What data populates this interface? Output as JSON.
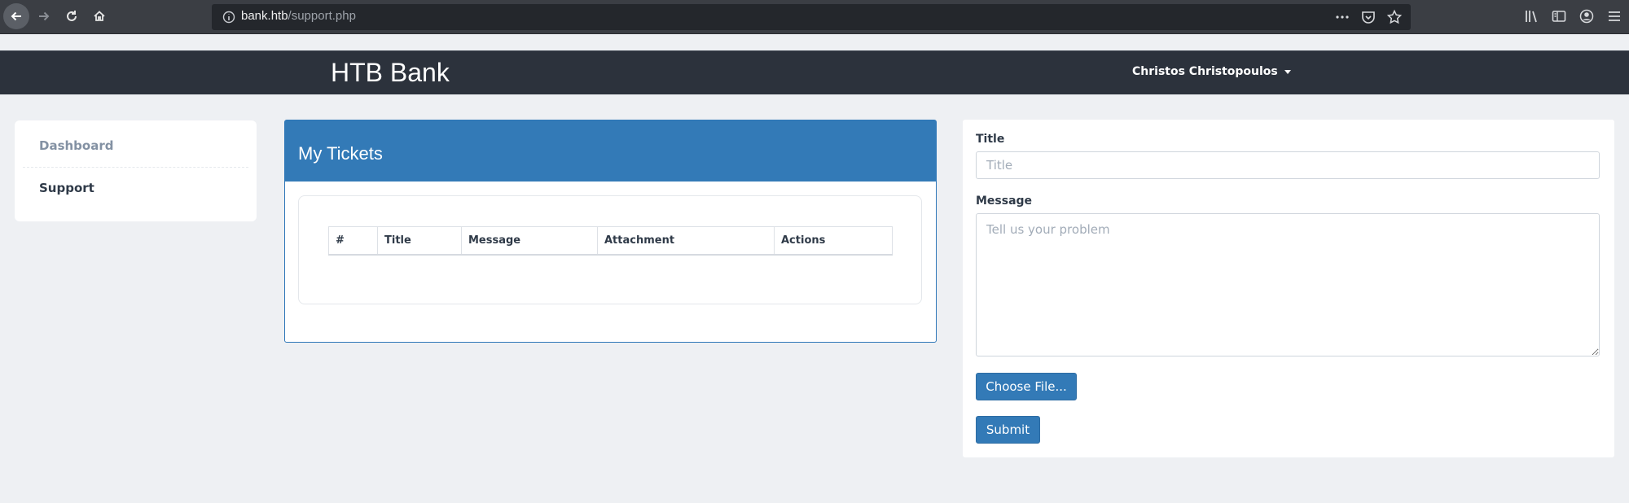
{
  "browser": {
    "url_host": "bank.htb",
    "url_path": "/support.php",
    "icons": [
      "back-arrow-icon",
      "forward-arrow-icon",
      "reload-icon",
      "home-icon",
      "info-icon",
      "more-dots-icon",
      "pocket-icon",
      "bookmark-star-icon",
      "library-icon",
      "sidebar-icon",
      "account-icon",
      "hamburger-menu-icon"
    ]
  },
  "header": {
    "brand": "HTB Bank",
    "user_name": "Christos Christopoulos"
  },
  "sidebar": {
    "items": [
      {
        "label": "Dashboard"
      },
      {
        "label": "Support"
      }
    ]
  },
  "tickets": {
    "title": "My Tickets",
    "columns": [
      "#",
      "Title",
      "Message",
      "Attachment",
      "Actions"
    ],
    "rows": []
  },
  "form": {
    "title_label": "Title",
    "title_placeholder": "Title",
    "message_label": "Message",
    "message_placeholder": "Tell us your problem",
    "choose_file_label": "Choose File...",
    "submit_label": "Submit"
  },
  "colors": {
    "primary": "#337ab7",
    "header_bg": "#2c323c",
    "page_bg": "#eef0f3"
  }
}
